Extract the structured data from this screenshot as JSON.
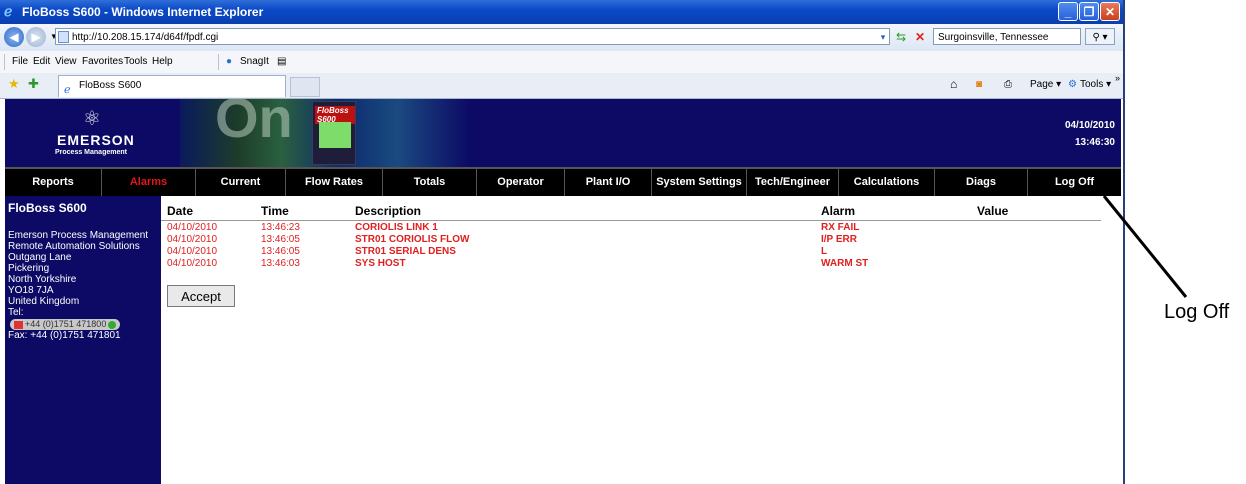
{
  "window": {
    "title": "FloBoss S600 - Windows Internet Explorer",
    "minimize": "_",
    "maximize": "❐",
    "close": "✕"
  },
  "addressbar": {
    "url": "http://10.208.15.174/d64f/fpdf.cgi",
    "search_value": "Surgoinsville, Tennessee"
  },
  "menubar": {
    "items": [
      "File",
      "Edit",
      "View",
      "Favorites",
      "Tools",
      "Help"
    ],
    "snagit": "SnagIt"
  },
  "tabbar": {
    "tab_label": "FloBoss S600",
    "page_label": "Page ▾",
    "tools_label": "Tools ▾"
  },
  "header": {
    "logo_word": "EMERSON",
    "logo_sub": "Process Management",
    "device_brand": "FloBoss S600",
    "date": "04/10/2010",
    "time": "13:46:30"
  },
  "nav": {
    "items": [
      "Reports",
      "Alarms",
      "Current",
      "Flow Rates",
      "Totals",
      "Operator",
      "Plant I/O",
      "System Settings",
      "Tech/Engineer",
      "Calculations",
      "Diags",
      "Log Off"
    ],
    "active": "Alarms"
  },
  "sidebar": {
    "title": "FloBoss S600",
    "lines": [
      "Emerson Process Management",
      "Remote Automation Solutions",
      "Outgang Lane",
      "Pickering",
      "North Yorkshire",
      "YO18 7JA",
      "United Kingdom",
      "Tel:"
    ],
    "tel": "+44 (0)1751 471800",
    "fax": "Fax: +44 (0)1751 471801"
  },
  "alarms": {
    "headers": {
      "date": "Date",
      "time": "Time",
      "description": "Description",
      "alarm": "Alarm",
      "value": "Value"
    },
    "rows": [
      {
        "date": "04/10/2010",
        "time": "13:46:23",
        "description": "CORIOLIS LINK 1",
        "alarm": "RX FAIL",
        "value": ""
      },
      {
        "date": "04/10/2010",
        "time": "13:46:05",
        "description": "STR01 CORIOLIS FLOW",
        "alarm": "I/P ERR",
        "value": ""
      },
      {
        "date": "04/10/2010",
        "time": "13:46:05",
        "description": "STR01 SERIAL DENS",
        "alarm": "L",
        "value": ""
      },
      {
        "date": "04/10/2010",
        "time": "13:46:03",
        "description": "SYS HOST",
        "alarm": "WARM ST",
        "value": ""
      }
    ],
    "accept_label": "Accept"
  },
  "callout": {
    "label": "Log Off"
  }
}
